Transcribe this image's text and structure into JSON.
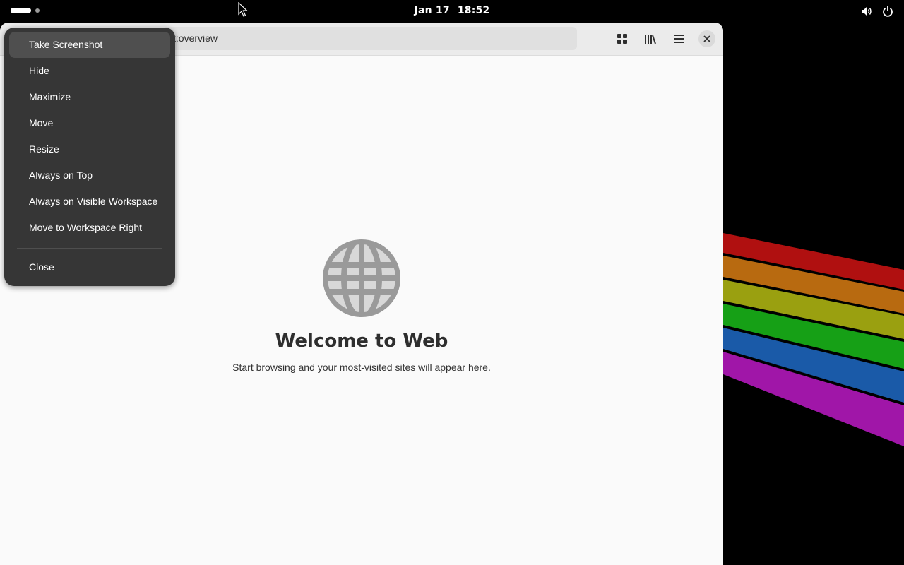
{
  "topbar": {
    "date": "Jan 17",
    "time": "18:52",
    "icons": [
      "volume-icon",
      "power-icon"
    ]
  },
  "browser": {
    "url": "t:overview",
    "toolbar_icons": [
      "tabs-overview-icon",
      "library-icon",
      "main-menu-icon",
      "close-icon"
    ],
    "welcome_title": "Welcome to Web",
    "welcome_subtitle": "Start browsing and your most-visited sites will appear here."
  },
  "window_menu": {
    "items": [
      "Take Screenshot",
      "Hide",
      "Maximize",
      "Move",
      "Resize",
      "Always on Top",
      "Always on Visible Workspace",
      "Move to Workspace Right",
      "Close"
    ],
    "highlighted": "Take Screenshot"
  },
  "colors": {
    "menu_bg": "#363636",
    "menu_hover": "#4f4f4f",
    "window_bg": "#fafafa",
    "headerbar_bg": "#ebebeb",
    "globe": "#9a9a9a"
  }
}
